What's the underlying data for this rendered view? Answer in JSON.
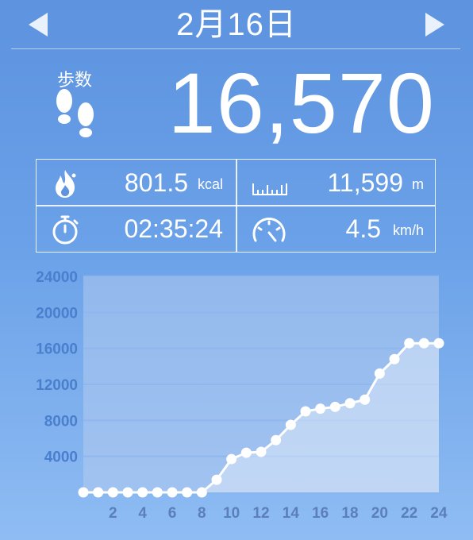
{
  "header": {
    "date": "2月16日",
    "prev_icon": "triangle-left-icon",
    "next_icon": "triangle-right-icon"
  },
  "steps": {
    "label": "歩数",
    "value": "16,570",
    "icon": "footprints-icon"
  },
  "stats": {
    "calories": {
      "value": "801.5",
      "unit": "kcal",
      "icon": "flame-icon"
    },
    "distance": {
      "value": "11,599",
      "unit": "m",
      "icon": "ruler-icon"
    },
    "duration": {
      "value": "02:35:24",
      "icon": "stopwatch-icon"
    },
    "speed": {
      "value": "4.5",
      "unit": "km/h",
      "icon": "speedometer-icon"
    }
  },
  "colors": {
    "background_top": "#5d93df",
    "background_bottom": "#8fbcf3",
    "y_tick_label": "#4a7fce",
    "x_tick_label": "#5b7fb8",
    "grid_line": "#8fb7ee",
    "plot_fill": "#b7cdf0"
  },
  "chart_data": {
    "type": "line",
    "title": "",
    "xlabel": "",
    "ylabel": "",
    "x": [
      0,
      1,
      2,
      3,
      4,
      5,
      6,
      7,
      8,
      9,
      10,
      11,
      12,
      13,
      14,
      15,
      16,
      17,
      18,
      19,
      20,
      21,
      22,
      23,
      24
    ],
    "values": [
      0,
      0,
      0,
      0,
      0,
      0,
      0,
      0,
      0,
      1400,
      3700,
      4400,
      4500,
      5800,
      7500,
      9000,
      9300,
      9500,
      9900,
      10300,
      13200,
      14800,
      16570,
      16570,
      16570
    ],
    "xlim": [
      0,
      24
    ],
    "ylim": [
      0,
      24000
    ],
    "y_ticks": [
      4000,
      8000,
      12000,
      16000,
      20000,
      24000
    ],
    "y_tick_labels": [
      "4000",
      "8000",
      "12000",
      "16000",
      "20000",
      "24000"
    ],
    "x_ticks": [
      2,
      4,
      6,
      8,
      10,
      12,
      14,
      16,
      18,
      20,
      22,
      24
    ],
    "x_tick_labels": [
      "2",
      "4",
      "6",
      "8",
      "10",
      "12",
      "14",
      "16",
      "18",
      "20",
      "22",
      "24"
    ],
    "grid": true,
    "markers": true
  }
}
